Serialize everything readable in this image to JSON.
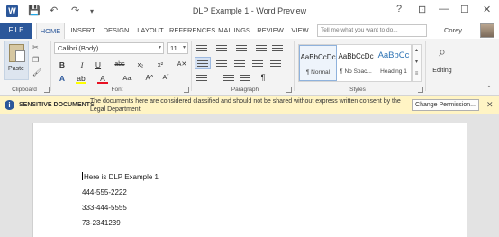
{
  "titlebar": {
    "title": "DLP Example 1 - Word Preview",
    "help": "?",
    "window_buttons": [
      "—",
      "☐",
      "✕"
    ]
  },
  "tabs": {
    "file": "FILE",
    "items": [
      "HOME",
      "INSERT",
      "DESIGN",
      "LAYOUT",
      "REFERENCES",
      "MAILINGS",
      "REVIEW",
      "VIEW"
    ],
    "active": "HOME",
    "tell_me_placeholder": "Tell me what you want to do...",
    "user": "Corey..."
  },
  "ribbon": {
    "clipboard": {
      "paste": "Paste",
      "label": "Clipboard"
    },
    "font": {
      "name": "Calibri (Body)",
      "size": "11",
      "label": "Font"
    },
    "paragraph": {
      "label": "Paragraph"
    },
    "styles": {
      "label": "Styles",
      "items": [
        {
          "sample": "AaBbCcDc",
          "name": "¶ Normal"
        },
        {
          "sample": "AaBbCcDc",
          "name": "¶ No Spac..."
        },
        {
          "sample": "AaBbCc",
          "name": "Heading 1"
        }
      ]
    },
    "editing": {
      "label": "Editing"
    }
  },
  "infobar": {
    "title": "SENSITIVE DOCUMENTS",
    "message": "The documents here are considered classified and should not be shared without express written consent by the Legal Department.",
    "button": "Change Permission..."
  },
  "document": {
    "lines": [
      "Here is DLP Example 1",
      "444-555-2222",
      "333-444-5555",
      "73-2341239"
    ]
  },
  "colors": {
    "accent": "#2b579a",
    "infobar_bg": "#fff4c4"
  }
}
